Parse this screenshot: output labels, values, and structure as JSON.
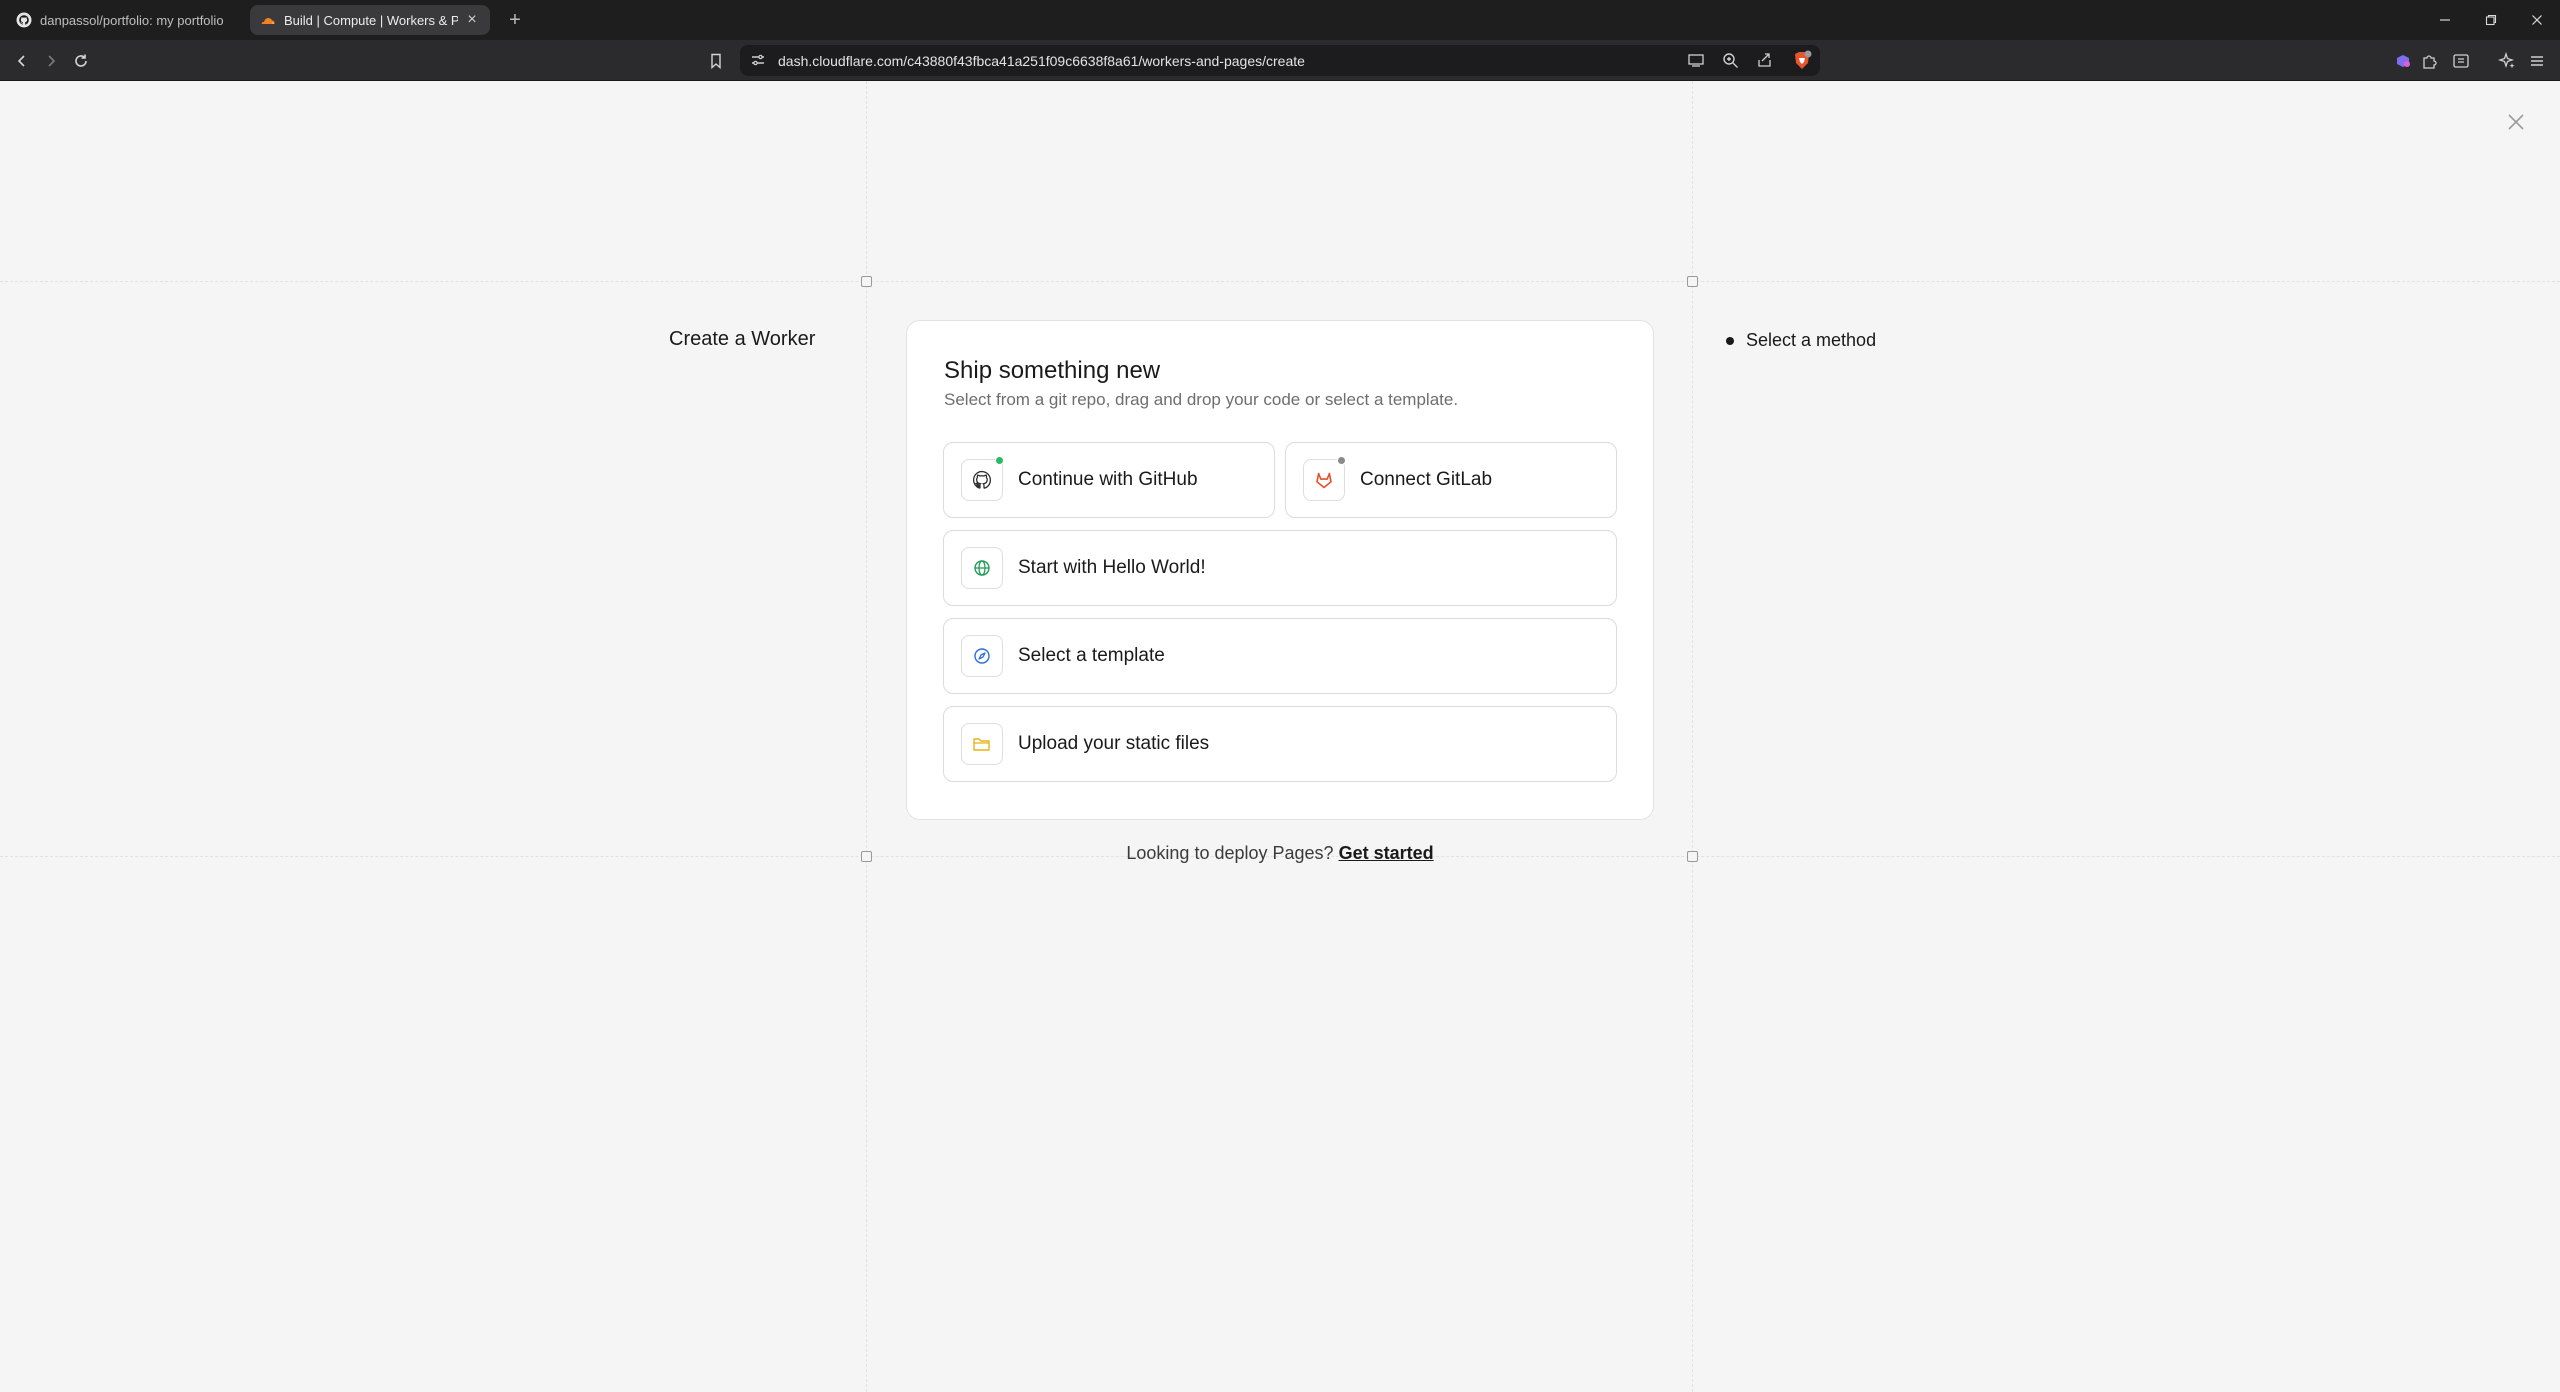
{
  "browser": {
    "tabs": [
      {
        "label": "danpassol/portfolio: my portfolio",
        "icon": "github-icon",
        "active": false
      },
      {
        "label": "Build | Compute | Workers & Pag",
        "icon": "cloudflare-icon",
        "active": true
      }
    ],
    "address": {
      "url": "dash.cloudflare.com/c43880f43fbca41a251f09c6638f8a61/workers-and-pages/create"
    }
  },
  "page": {
    "side_title": "Create a Worker",
    "step_label": "Select a method",
    "card": {
      "title": "Ship something new",
      "subtitle": "Select from a git repo, drag and drop your code or select a template.",
      "options": [
        {
          "label": "Continue with GitHub",
          "icon": "github-icon",
          "badge_color": "#2db865"
        },
        {
          "label": "Connect GitLab",
          "icon": "gitlab-icon",
          "badge_color": "#8a8a8a"
        },
        {
          "label": "Start with Hello World!",
          "icon": "globe-icon",
          "icon_color": "#1f9d55"
        },
        {
          "label": "Select a template",
          "icon": "compass-icon",
          "icon_color": "#2b6fd6"
        },
        {
          "label": "Upload your static files",
          "icon": "folder-icon",
          "icon_color": "#e7b21a"
        }
      ]
    },
    "footer": {
      "text": "Looking to deploy Pages?",
      "link": "Get started"
    }
  },
  "colors": {
    "background": "#f5f5f5",
    "card": "#ffffff",
    "gitlab_orange": "#e2522a"
  }
}
